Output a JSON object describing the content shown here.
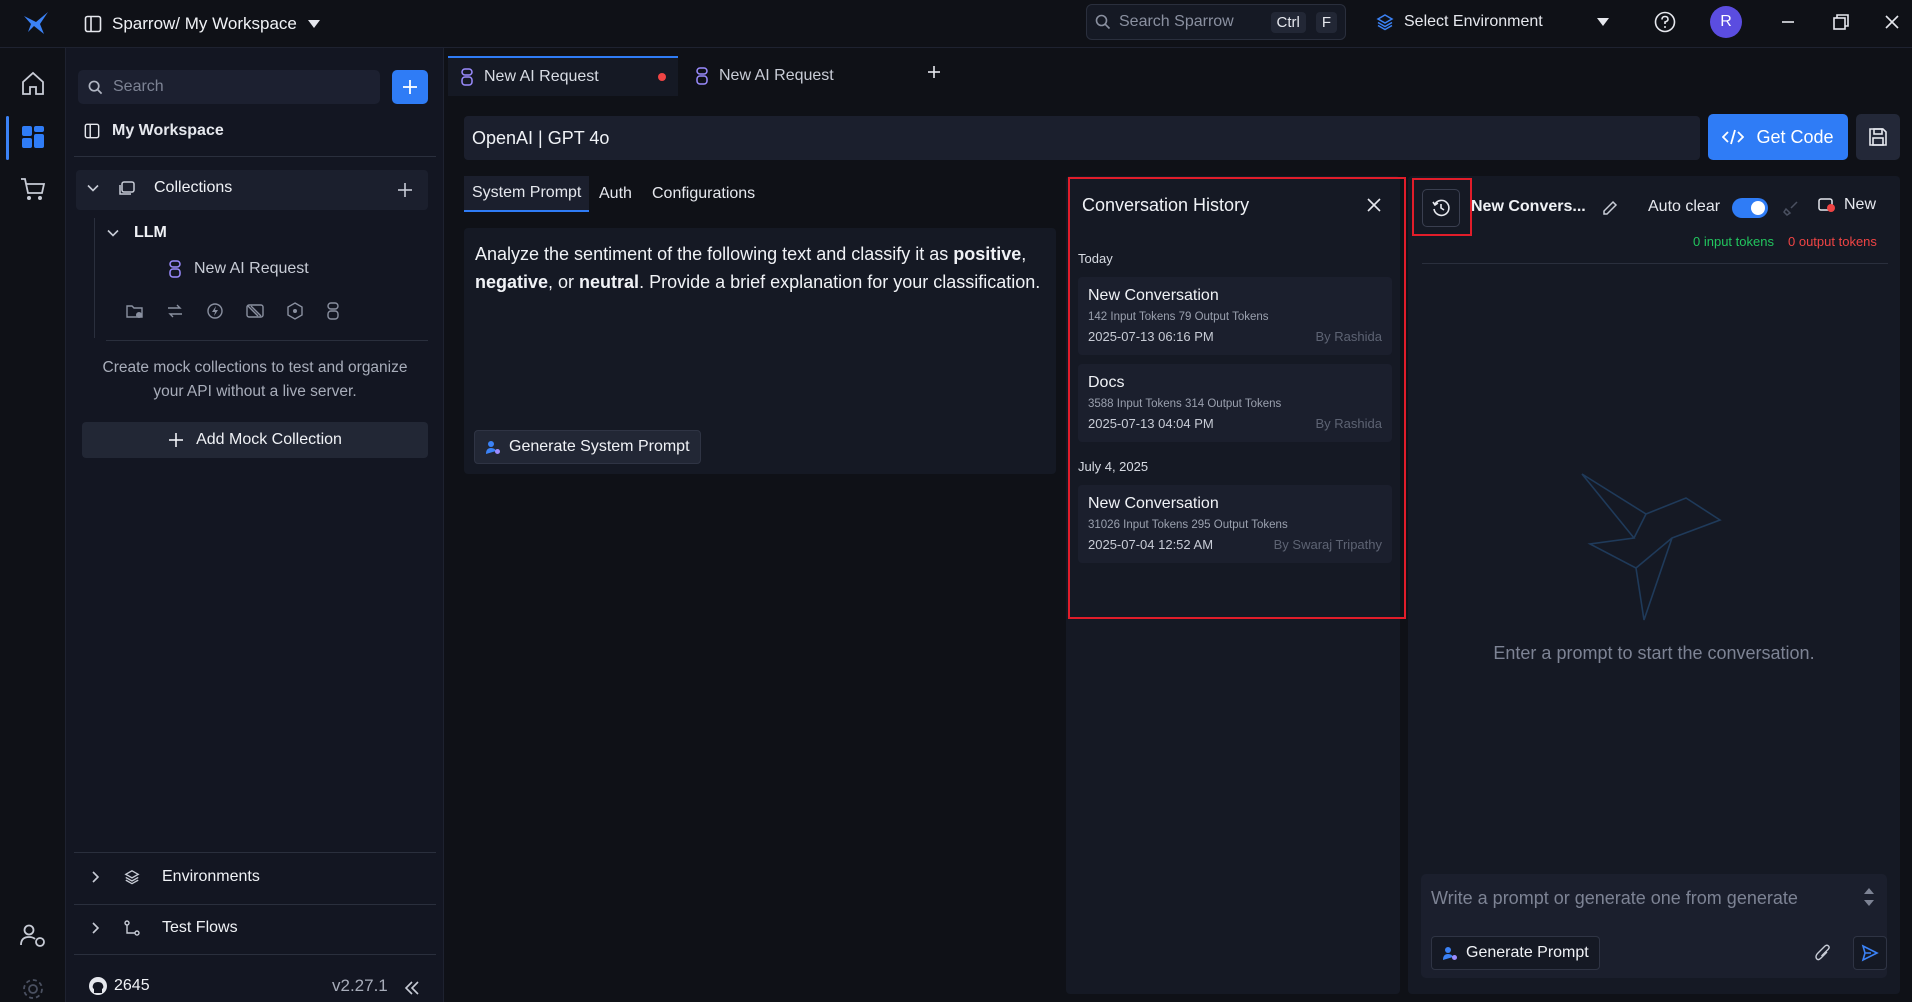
{
  "topbar": {
    "workspace_label": "Sparrow/ My Workspace",
    "search_placeholder": "Search Sparrow",
    "shortcut_ctrl": "Ctrl",
    "shortcut_key": "F",
    "environment_label": "Select Environment",
    "avatar_initial": "R"
  },
  "sidebar": {
    "search_placeholder": "Search",
    "workspace_title": "My Workspace",
    "collections_label": "Collections",
    "folder_label": "LLM",
    "request_label": "New AI Request",
    "mock_text": "Create mock collections to test and organize your API without a live server.",
    "mock_button_label": "Add Mock Collection",
    "environments_label": "Environments",
    "testflows_label": "Test Flows",
    "github_stars": "2645",
    "version": "v2.27.1"
  },
  "tabs": [
    {
      "label": "New AI Request",
      "unsaved": true
    },
    {
      "label": "New AI Request",
      "unsaved": false
    }
  ],
  "request": {
    "model": "OpenAI | GPT 4o",
    "get_code_label": "Get Code",
    "tabs": [
      "System Prompt",
      "Auth",
      "Configurations"
    ],
    "prompt": {
      "part1": "Analyze the sentiment of the following text and classify it as ",
      "bold1": "positive",
      "sep1": ", ",
      "bold2": "negative",
      "sep2": ", or ",
      "bold3": "neutral",
      "part2": ". Provide a brief explanation for your classification."
    },
    "generate_system_prompt_label": "Generate System Prompt"
  },
  "history": {
    "title": "Conversation History",
    "groups": [
      {
        "label": "Today",
        "items": [
          {
            "name": "New Conversation",
            "tokens": "142 Input Tokens  79 Output Tokens",
            "date": "2025-07-13   06:16 PM",
            "by": "By Rashida"
          },
          {
            "name": "Docs",
            "tokens": "3588 Input Tokens  314 Output Tokens",
            "date": "2025-07-13   04:04 PM",
            "by": "By Rashida"
          }
        ]
      },
      {
        "label": "July 4, 2025",
        "items": [
          {
            "name": "New Conversation",
            "tokens": "31026 Input Tokens  295 Output Tokens",
            "date": "2025-07-04   12:52 AM",
            "by": "By Swaraj Tripathy"
          }
        ]
      }
    ]
  },
  "chat": {
    "title": "New Convers...",
    "autoclear_label": "Auto clear",
    "autoclear_on": true,
    "new_label": "New",
    "input_tokens": "0 input tokens",
    "output_tokens": "0 output tokens",
    "empty_text": "Enter a prompt to start the conversation.",
    "input_placeholder": "Write a prompt or generate one from generate",
    "generate_prompt_label": "Generate Prompt"
  },
  "colors": {
    "accent": "#2f7cf6",
    "highlight": "#e11d2a",
    "input_tokens": "#22c55e",
    "output_tokens": "#ef4444"
  }
}
